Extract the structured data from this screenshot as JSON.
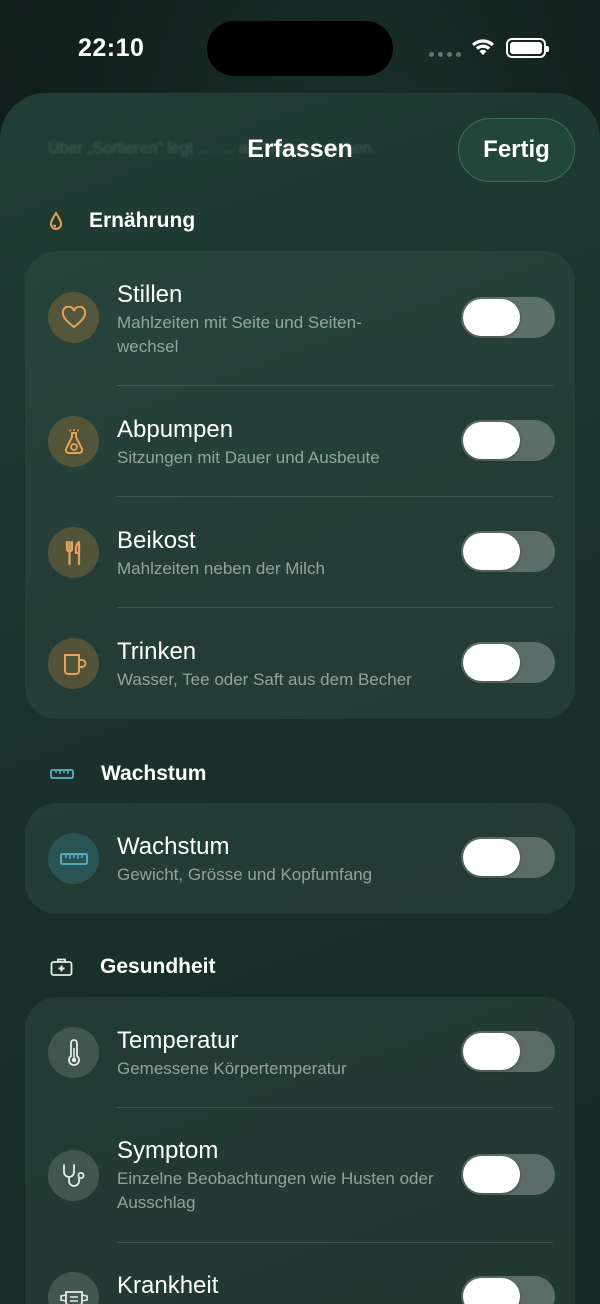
{
  "status_bar": {
    "time": "22:10"
  },
  "sheet": {
    "background_text": "Über „Sortieren\" legt … … auf „Heute\" stehen.",
    "title": "Erfassen",
    "done_label": "Fertig"
  },
  "sections": {
    "nutrition": {
      "title": "Ernährung",
      "icon": "drop-icon",
      "accent": "#e5a25a",
      "items": [
        {
          "title": "Stillen",
          "subtitle": "Mahlzeiten mit Seite und Seiten-wechsel",
          "icon": "heart-icon",
          "enabled": false
        },
        {
          "title": "Abpumpen",
          "subtitle": "Sitzungen mit Dauer und Ausbeute",
          "icon": "breast-pump-icon",
          "enabled": false
        },
        {
          "title": "Beikost",
          "subtitle": "Mahlzeiten neben der Milch",
          "icon": "fork-knife-icon",
          "enabled": false
        },
        {
          "title": "Trinken",
          "subtitle": "Wasser, Tee oder Saft aus dem Becher",
          "icon": "cup-icon",
          "enabled": false
        }
      ]
    },
    "growth": {
      "title": "Wachstum",
      "icon": "ruler-icon",
      "accent": "#5ab4c8",
      "items": [
        {
          "title": "Wachstum",
          "subtitle": "Gewicht, Grösse und Kopfumfang",
          "icon": "ruler-icon",
          "enabled": false
        }
      ]
    },
    "health": {
      "title": "Gesundheit",
      "icon": "medical-kit-icon",
      "accent": "#e8ecea",
      "items": [
        {
          "title": "Temperatur",
          "subtitle": "Gemessene Körpertemperatur",
          "icon": "thermometer-icon",
          "enabled": false
        },
        {
          "title": "Symptom",
          "subtitle": "Einzelne Beobachtungen wie Husten oder Ausschlag",
          "icon": "stethoscope-icon",
          "enabled": false
        },
        {
          "title": "Krankheit",
          "subtitle": "",
          "icon": "face-mask-icon",
          "enabled": false
        }
      ]
    }
  }
}
